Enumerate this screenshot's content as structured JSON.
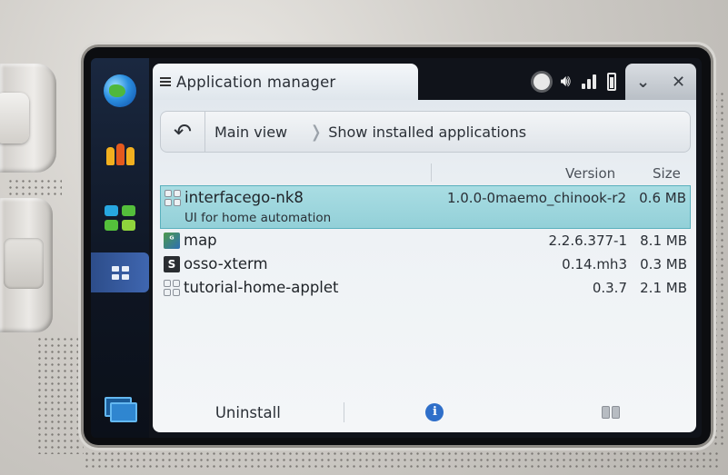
{
  "titlebar": {
    "title": "Application manager",
    "minimize_glyph": "⌄",
    "close_glyph": "✕"
  },
  "status_icons": [
    "brightness-icon",
    "volume-icon",
    "wifi-icon",
    "battery-icon"
  ],
  "breadcrumb": {
    "back_glyph": "↶",
    "items": [
      "Main view",
      "Show installed applications"
    ],
    "separator": "❭"
  },
  "columns": {
    "version": "Version",
    "size": "Size"
  },
  "packages": [
    {
      "name": "interfacego-nk8",
      "description": "UI for home automation",
      "version": "1.0.0-0maemo_chinook-r2",
      "size": "0.6 MB",
      "icon": "package-generic-icon",
      "selected": true
    },
    {
      "name": "map",
      "description": "",
      "version": "2.2.6.377-1",
      "size": "8.1 MB",
      "icon": "map-app-icon",
      "icon_text": "ᴳ",
      "selected": false
    },
    {
      "name": "osso-xterm",
      "description": "",
      "version": "0.14.mh3",
      "size": "0.3 MB",
      "icon": "terminal-icon",
      "icon_text": "S",
      "selected": false
    },
    {
      "name": "tutorial-home-applet",
      "description": "",
      "version": "0.3.7",
      "size": "2.1 MB",
      "icon": "package-generic-icon",
      "selected": false
    }
  ],
  "toolbar": {
    "uninstall_label": "Uninstall",
    "info_glyph": "i"
  },
  "colors": {
    "selection": "#a9dde3",
    "accent": "#2f6fc9",
    "navigator": "#0e1522"
  }
}
